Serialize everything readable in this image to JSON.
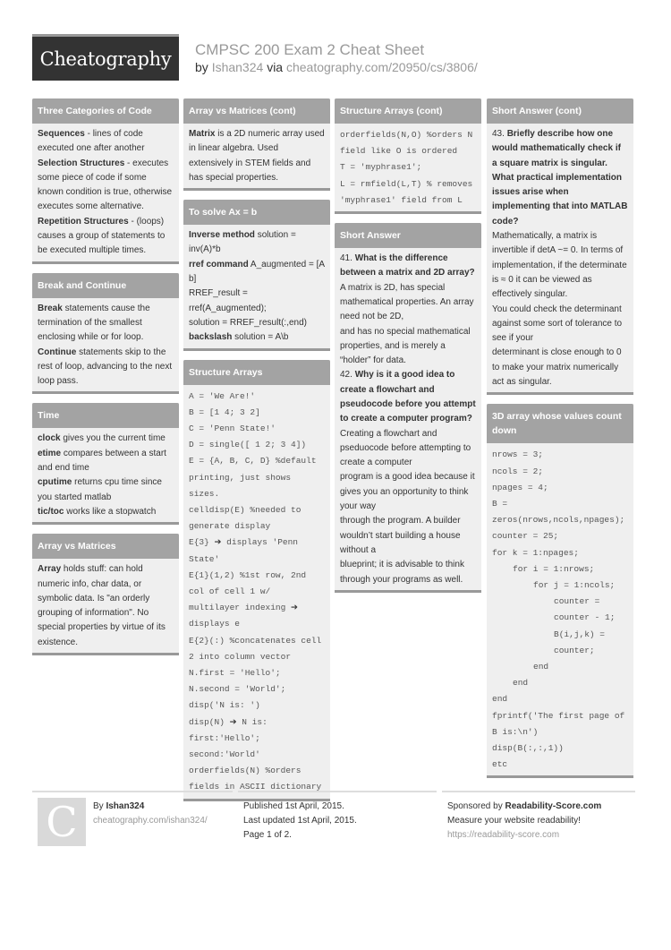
{
  "header": {
    "logo": "Cheatography",
    "title": "CMPSC 200 Exam 2 Cheat Sheet",
    "by": "by",
    "author": "Ishan324",
    "via": "via",
    "url": "cheatography.com/20950/cs/3806/"
  },
  "sections": {
    "three_categories": {
      "title": "Three Categories of Code",
      "items": [
        {
          "term": "Sequences",
          "text": " - lines of code executed one after another"
        },
        {
          "term": "Selection Structures",
          "text": " - executes some piece of code if some known condition is true, otherwise executes some alternative."
        },
        {
          "term": "Repetition Structures",
          "text": " - (loops) causes a group of statements to be executed multiple times."
        }
      ]
    },
    "break_continue": {
      "title": "Break and Continue",
      "items": [
        {
          "term": "Break",
          "text": " statements cause the termination of the smallest enclosing while or for loop."
        },
        {
          "term": "Continue",
          "text": " statements skip to the rest of loop, advancing to the next loop pass."
        }
      ]
    },
    "time": {
      "title": "Time",
      "items": [
        {
          "term": "clock",
          "text": " gives you the current time"
        },
        {
          "term": "etime",
          "text": " compares between a start and end time"
        },
        {
          "term": "cputime",
          "text": " returns cpu time since you started matlab"
        },
        {
          "term": "tic/toc",
          "text": " works like a stopwatch"
        }
      ]
    },
    "array_vs_matrices": {
      "title": "Array vs Matrices",
      "items": [
        {
          "term": "Array",
          "text": " holds stuff: can hold numeric info, char data, or symbolic data. Is \"an orderly grouping of information\". No special properties by virtue of its existence."
        }
      ]
    },
    "array_vs_matrices_cont": {
      "title": "Array vs Matrices (cont)",
      "items": [
        {
          "term": "Matrix",
          "text": " is a 2D numeric array used in linear algebra. Used extensively in STEM fields and has special properties."
        }
      ]
    },
    "solve_axb": {
      "title": "To solve Ax = b",
      "items": [
        {
          "term": "Inverse method",
          "text": " solution = inv(A)*b"
        },
        {
          "term": "rref command",
          "text": " A_augmented = [A b]"
        },
        {
          "term": "",
          "text": "RREF_result = rref(A_augmented);"
        },
        {
          "term": "",
          "text": "solution = RREF_result(:,end)"
        },
        {
          "term": "backslash",
          "text": " solution = A\\b"
        }
      ]
    },
    "structure_arrays": {
      "title": "Structure Arrays",
      "lines": [
        "A = 'We Are!'",
        "B = [1 4; 3 2]",
        "C = 'Penn State!'",
        "D = single([ 1 2; 3 4])",
        "E = {A, B, C, D} %default printing, just shows sizes.",
        "celldisp(E) %needed to generate display",
        "E{3} ➔ displays 'Penn State'",
        "E{1}(1,2) %1st row, 2nd col of cell 1 w/ multilayer indexing ➔ displays e",
        "E{2}(:) %concatenates cell 2 into column vector",
        "N.first = 'Hello';",
        "N.second = 'World';",
        "disp('N is: ')",
        "disp(N) ➔ N is: first:'Hello'; second:'World'",
        "orderfields(N) %orders fields in ASCII dictionary"
      ]
    },
    "structure_arrays_cont": {
      "title": "Structure Arrays (cont)",
      "lines": [
        "orderfields(N,O) %orders N field like O is ordered",
        "T = 'myphrase1';",
        "L = rmfield(L,T) % removes 'myphrase1' field from L"
      ]
    },
    "short_answer": {
      "title": "Short Answer",
      "qa": [
        {
          "num": "41. ",
          "question": "What is the difference between a matrix and 2D array?",
          "answer": [
            "A matrix is 2D, has special mathematical properties. An array need not be 2D,",
            "and has no special mathematical properties, and is merely a “holder” for data."
          ]
        },
        {
          "num": "42. ",
          "question": "Why is it a good idea to create a flowchart and pseudocode before you attempt to create a computer program?",
          "answer": [
            "Creating a flowchart and pseduocode before attempting to create a computer",
            "program is a good idea because it gives you an opportunity to think your way",
            "through the program. A builder wouldn’t start building a house without a",
            "blueprint; it is advisable to think through your programs as well."
          ]
        }
      ]
    },
    "short_answer_cont": {
      "title": "Short Answer (cont)",
      "qa": [
        {
          "num": "43. ",
          "question": "Briefly describe how one would mathematically check if a square matrix is singular. What practical implementation issues arise when implementing that into MATLAB code?",
          "answer": [
            "Mathematically, a matrix is invertible if detA ~= 0. In terms of implementation, if the determinate is ≈ 0 it can be viewed as effectively singular.",
            "You could check the determinant against some sort of tolerance to see if your",
            "determinant is close enough to 0 to make your matrix numerically act as singular."
          ]
        }
      ]
    },
    "array_3d": {
      "title": "3D array whose values count down",
      "lines": [
        {
          "indent": 0,
          "text": "nrows = 3;"
        },
        {
          "indent": 0,
          "text": "ncols = 2;"
        },
        {
          "indent": 0,
          "text": "npages = 4;"
        },
        {
          "indent": 0,
          "text": "B = zeros(nrows,ncols,npages);"
        },
        {
          "indent": 0,
          "text": "counter = 25;"
        },
        {
          "indent": 0,
          "text": "for k = 1:npages;"
        },
        {
          "indent": 1,
          "text": "for i = 1:nrows;"
        },
        {
          "indent": 2,
          "text": "for j = 1:ncols;"
        },
        {
          "indent": 3,
          "text": "counter = counter - 1;"
        },
        {
          "indent": 3,
          "text": "B(i,j,k) = counter;"
        },
        {
          "indent": 2,
          "text": "end"
        },
        {
          "indent": 1,
          "text": "end"
        },
        {
          "indent": 0,
          "text": "end"
        },
        {
          "indent": 0,
          "text": "fprintf('The first page of B is:\\n')"
        },
        {
          "indent": 0,
          "text": "disp(B(:,:,1))"
        },
        {
          "indent": 0,
          "text": "etc"
        }
      ]
    }
  },
  "footer": {
    "avatar_letter": "C",
    "by": "By ",
    "author": "Ishan324",
    "author_url": "cheatography.com/ishan324/",
    "published": "Published 1st April, 2015.",
    "updated": "Last updated 1st April, 2015.",
    "page": "Page 1 of 2.",
    "sponsored_by": "Sponsored by ",
    "sponsor": "Readability-Score.com",
    "sponsor_tagline": "Measure your website readability!",
    "sponsor_url": "https://readability-score.com"
  }
}
